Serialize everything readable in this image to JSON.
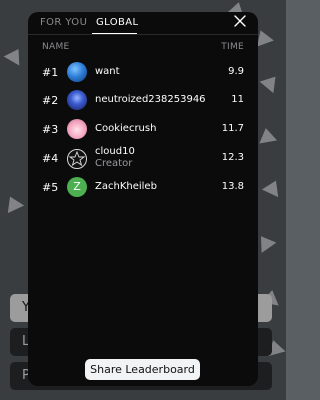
{
  "background": {
    "buttons": [
      {
        "label": "Y",
        "style": "light"
      },
      {
        "label": "L",
        "style": "dark"
      },
      {
        "label": "P",
        "style": "dark"
      }
    ]
  },
  "modal": {
    "tabs": [
      {
        "label": "FOR YOU",
        "active": false
      },
      {
        "label": "GLOBAL",
        "active": true
      }
    ],
    "close_icon": "close-icon",
    "columns": {
      "name": "NAME",
      "time": "TIME"
    },
    "rows": [
      {
        "rank": "#1",
        "name": "want",
        "subtitle": "",
        "time": "9.9",
        "avatar": "earth-avatar"
      },
      {
        "rank": "#2",
        "name": "neutroized238253946",
        "subtitle": "",
        "time": "11",
        "avatar": "blue-figure-avatar"
      },
      {
        "rank": "#3",
        "name": "Cookiecrush",
        "subtitle": "",
        "time": "11.7",
        "avatar": "pink-girl-avatar"
      },
      {
        "rank": "#4",
        "name": "cloud10",
        "subtitle": "Creator",
        "time": "12.3",
        "avatar": "star-sketch-avatar"
      },
      {
        "rank": "#5",
        "name": "ZachKheileb",
        "subtitle": "",
        "time": "13.8",
        "avatar": "letter-z-avatar",
        "avatar_letter": "Z"
      }
    ],
    "share_label": "Share Leaderboard"
  },
  "colors": {
    "modal_bg": "#0b0b0c",
    "page_bg": "#5a5f63",
    "z_avatar": "#4caf50"
  }
}
